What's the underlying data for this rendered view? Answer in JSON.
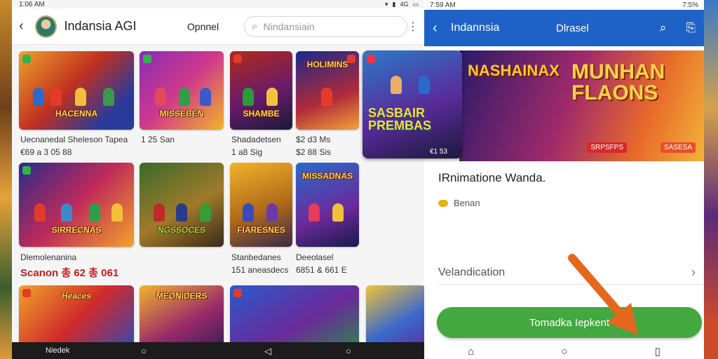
{
  "left": {
    "status": {
      "time": "1:06 AM",
      "right": "4G"
    },
    "header": {
      "title": "Indansia AGI",
      "tab": "Opnnel",
      "search_placeholder": "Nindansiain"
    },
    "cards": [
      {
        "title": "HACENNA",
        "captions": [
          "Uecnanedal Sheleson Tapea",
          "€69 a 3 05 88"
        ]
      },
      {
        "title": "MISSEBEN",
        "captions": [
          "1 25 San"
        ]
      },
      {
        "title": "SHAMBE",
        "captions": [
          "Shadadetsen",
          "1 a8 Sig"
        ]
      },
      {
        "title": "HOLIMINS",
        "captions": [
          "$2 d3 Ms",
          "$2 88 Sis"
        ]
      },
      {
        "title": "SIRRECNAS",
        "captions": [
          "Dlemolenanina",
          "Scanon 총 62 총 061"
        ]
      },
      {
        "title": "NGSSOCES",
        "captions": []
      },
      {
        "title": "FIARESNES",
        "captions": [
          "Stanbedanes",
          "151 aneasdecs"
        ]
      },
      {
        "title": "MISSADNAS",
        "captions": [
          "Deeolasel",
          "6851 & 661 E"
        ]
      },
      {
        "title": "Heaces",
        "captions": []
      },
      {
        "title": "MEONIDERS",
        "captions": []
      },
      {
        "title": "",
        "captions": []
      },
      {
        "title": "",
        "captions": []
      }
    ],
    "navbar": {
      "back_label": "Niedek"
    }
  },
  "overlay_card": {
    "title": "SASBAIR PREMBAS",
    "counter": "€1 53"
  },
  "right": {
    "status": {
      "time": "7:59 AM",
      "right": "7:5%"
    },
    "appbar": {
      "title": "Indannsia",
      "subtitle": "Dlrasel"
    },
    "hero": {
      "left_title": "NASHAINAX",
      "right_title": "MUNHAN FLAONS",
      "label_a": "SRPSFPS",
      "label_b": "SASESA"
    },
    "app_name": "IRnimatione Wanda.",
    "developer": "Benan",
    "row_label": "Velandication",
    "install_label": "Tomadka Iepkent"
  },
  "colors": {
    "accent_blue": "#1f62c7",
    "install_green": "#43a83f",
    "arrow": "#e5671e"
  }
}
